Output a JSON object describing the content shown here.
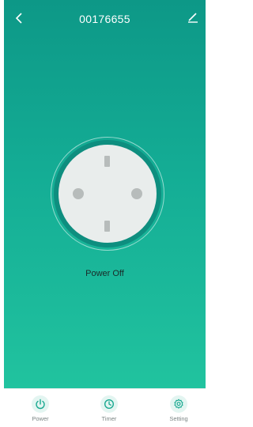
{
  "header": {
    "title": "00176655",
    "back_icon": "chevron-left-icon",
    "edit_icon": "pencil-icon"
  },
  "device": {
    "status_text": "Power Off"
  },
  "tabs": [
    {
      "label": "Power",
      "icon": "power-icon"
    },
    {
      "label": "Timer",
      "icon": "clock-icon"
    },
    {
      "label": "Setting",
      "icon": "gear-icon"
    }
  ],
  "colors": {
    "accent": "#13a893",
    "gradient_top": "#0d9887",
    "gradient_bottom": "#21c39f"
  }
}
